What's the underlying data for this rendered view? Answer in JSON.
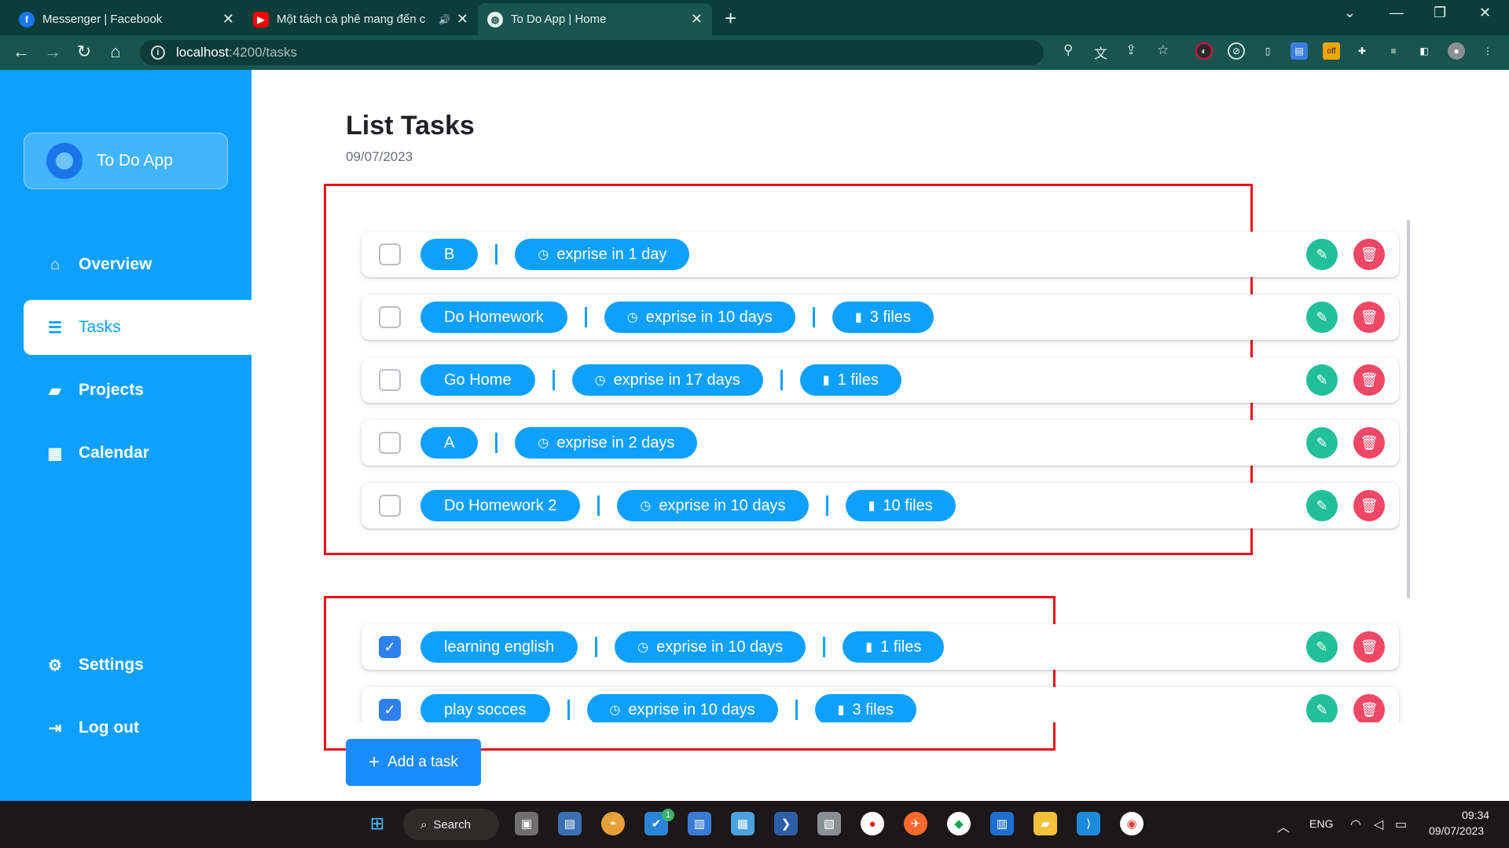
{
  "browser": {
    "tabs": [
      {
        "title": "Messenger | Facebook",
        "favicon": "facebook-icon",
        "color": "#1877f2"
      },
      {
        "title": "Một tách cà phê mang đến c",
        "favicon": "youtube-icon",
        "color": "#ff0000"
      },
      {
        "title": "To Do App | Home",
        "favicon": "globe-icon",
        "color": "#ffffff"
      }
    ],
    "url_host": "localhost",
    "url_path": ":4200/tasks"
  },
  "sidebar": {
    "brand": "To Do App",
    "items": [
      {
        "label": "Overview",
        "icon": "home-icon"
      },
      {
        "label": "Tasks",
        "icon": "list-icon"
      },
      {
        "label": "Projects",
        "icon": "folder-icon"
      },
      {
        "label": "Calendar",
        "icon": "calendar-icon"
      },
      {
        "label": "Settings",
        "icon": "gear-icon"
      },
      {
        "label": "Log out",
        "icon": "logout-icon"
      }
    ]
  },
  "main": {
    "title": "List Tasks",
    "date": "09/07/2023",
    "add_button": "Add a task",
    "pending_tasks": [
      {
        "name": "B",
        "expire": "exprise in 1 day",
        "files": "",
        "checked": false
      },
      {
        "name": "Do Homework",
        "expire": "exprise in 10 days",
        "files": "3 files",
        "checked": false
      },
      {
        "name": "Go Home",
        "expire": "exprise in 17 days",
        "files": "1 files",
        "checked": false
      },
      {
        "name": "A",
        "expire": "exprise in 2 days",
        "files": "",
        "checked": false
      },
      {
        "name": "Do Homework 2",
        "expire": "exprise in 10 days",
        "files": "10 files",
        "checked": false
      }
    ],
    "done_tasks": [
      {
        "name": "learning english",
        "expire": "exprise in 10 days",
        "files": "1 files",
        "checked": true
      },
      {
        "name": "play socces",
        "expire": "exprise in 10 days",
        "files": "3 files",
        "checked": true
      }
    ]
  },
  "taskbar": {
    "search": "Search",
    "language": "ENG",
    "time": "09:34",
    "date": "09/07/2023",
    "badge": "1"
  },
  "colors": {
    "sidebar": "#0ea0ff",
    "pill": "#0ea0ff",
    "edit": "#22c09a",
    "delete": "#ef4766",
    "highlight": "#e8101b",
    "add_button": "#1a8cff"
  }
}
